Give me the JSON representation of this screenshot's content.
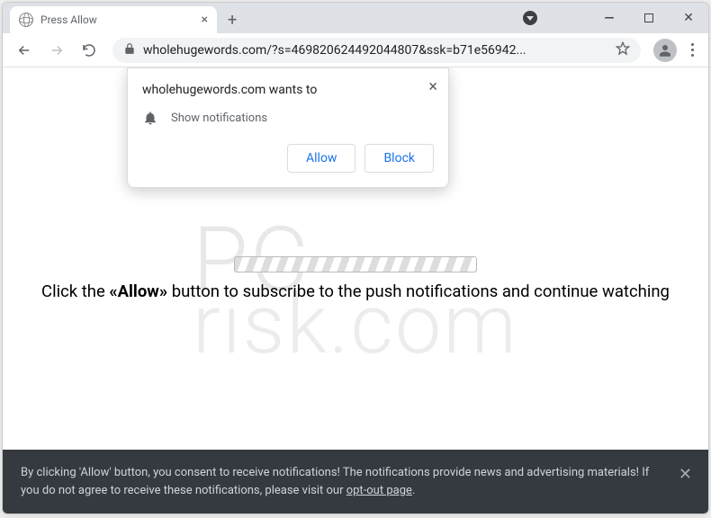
{
  "tab": {
    "title": "Press Allow"
  },
  "address": {
    "url": "wholehugewords.com/?s=469820624492044807&ssk=b71e56942..."
  },
  "permission": {
    "header": "wholehugewords.com wants to",
    "body": "Show notifications",
    "allow": "Allow",
    "block": "Block"
  },
  "page": {
    "instruction_pre": "Click the ",
    "instruction_bold": "«Allow»",
    "instruction_post": " button to subscribe to the push notifications and continue watching"
  },
  "consent": {
    "text": "By clicking 'Allow' button, you consent to receive notifications! The notifications provide news and advertising materials! If you do not agree to receive these notifications, please visit our ",
    "link": "opt-out page",
    "suffix": "."
  },
  "watermark": {
    "top": "PC",
    "bottom": "risk.com"
  }
}
